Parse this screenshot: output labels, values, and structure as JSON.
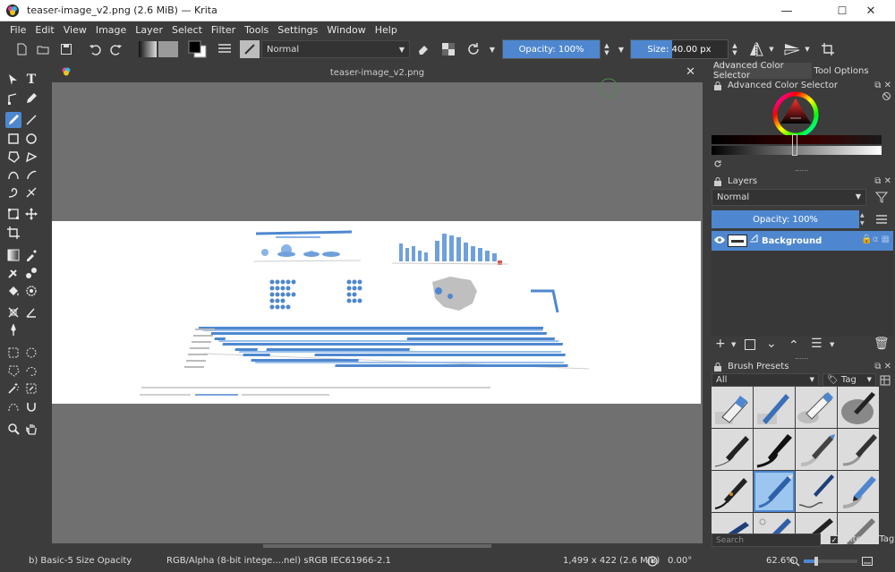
{
  "window": {
    "title": "teaser-image_v2.png (2.6 MiB)  — Krita",
    "minimize": "—",
    "maximize": "☐",
    "close": "✕"
  },
  "menu": [
    "File",
    "Edit",
    "View",
    "Image",
    "Layer",
    "Select",
    "Filter",
    "Tools",
    "Settings",
    "Window",
    "Help"
  ],
  "toolbar": {
    "blend_mode": "Normal",
    "opacity_label": "Opacity: 100%",
    "opacity_value": 1.0,
    "size_label": "Size: 40.00 px",
    "size_fill_fraction": 0.43
  },
  "document": {
    "tab_title": "teaser-image_v2.png",
    "close": "✕"
  },
  "dock": {
    "tabs": [
      "Advanced Color Selector",
      "Tool Options"
    ],
    "color_selector_title": "Advanced Color Selector",
    "layers_title": "Layers",
    "layer_blend_mode": "Normal",
    "layer_opacity_label": "Opacity:  100%",
    "layer_opacity_value": 1.0,
    "layers": [
      {
        "name": "Background",
        "visible": true
      }
    ],
    "brush_presets_title": "Brush Presets",
    "brush_filter": "All",
    "tag_label": "Tag",
    "search_placeholder": "Search",
    "filter_in_tag_label": "Filter in Tag",
    "filter_in_tag_checked": true
  },
  "status": {
    "brush": "b) Basic-5 Size Opacity",
    "colorspace": "RGB/Alpha (8-bit intege....nel)  sRGB IEC61966-2.1",
    "dimensions": "1,499 x 422 (2.6 MiB)",
    "rotation": "0.00°",
    "zoom": "62.6%"
  },
  "colors": {
    "accent": "#4e87cf",
    "panel_bg": "#3c3c3c",
    "canvas_bg": "#707070"
  }
}
